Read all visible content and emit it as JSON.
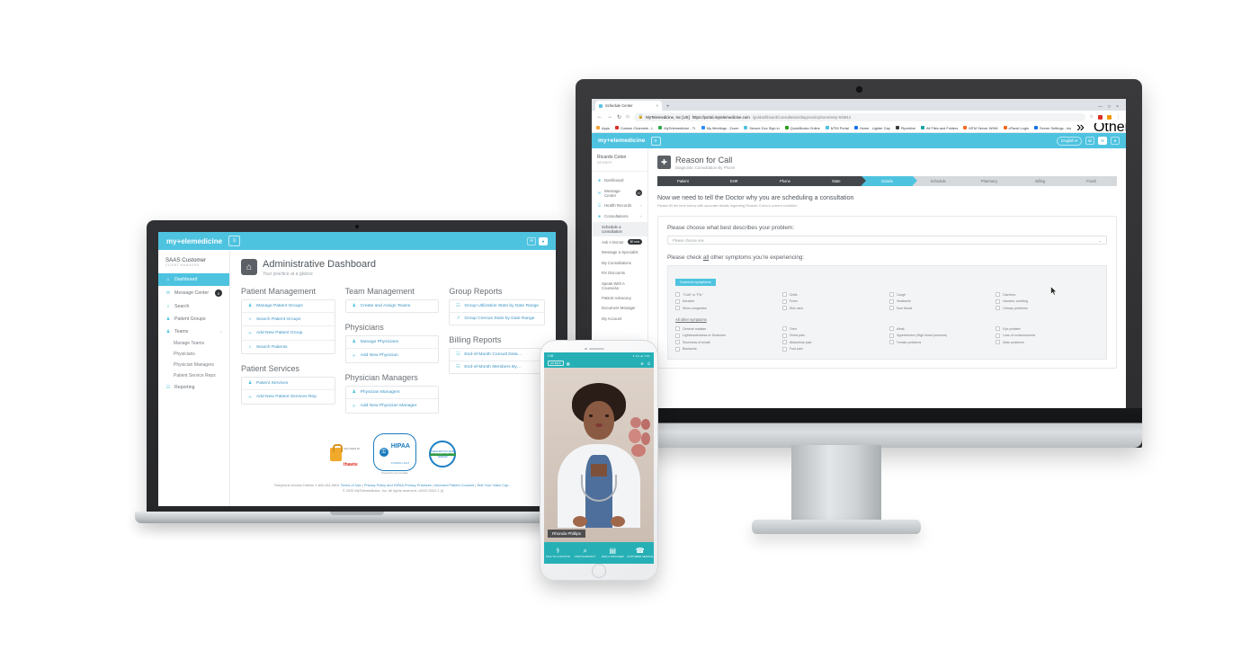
{
  "browser": {
    "tab_title": "Schedule Center",
    "tab_close": "×",
    "new_tab": "+",
    "secure_label": "MyTelemedicine, Inc [US]",
    "url_strong": "https://portal.mytelemedicine.com",
    "url_dim": "/go/dashboard/consultation/diagnostic/phone/step-5/8944",
    "bookmarks": [
      {
        "label": "Apps",
        "color": "#f2a43a"
      },
      {
        "label": "Custom Channels - L",
        "color": "#d93025"
      },
      {
        "label": "MyTelemedicine - Ti.",
        "color": "#34a853"
      },
      {
        "label": "My Meetings - Zoom",
        "color": "#2d8cff"
      },
      {
        "label": "Secure Doc Sign in",
        "color": "#4ec3e0"
      },
      {
        "label": "QuickBooks Online",
        "color": "#2ca01c"
      },
      {
        "label": "MTM Portal",
        "color": "#4ec3e0"
      },
      {
        "label": "Home - Lighter Cap",
        "color": "#1a73e8"
      },
      {
        "label": "Pipedrive",
        "color": "#3c3c3c"
      },
      {
        "label": "All Files and Folders",
        "color": "#1aa3a3"
      },
      {
        "label": "MTM Server WHM",
        "color": "#f26d21"
      },
      {
        "label": "cPanel Login",
        "color": "#f26d21"
      },
      {
        "label": "Server Settings - ins",
        "color": "#1a73e8"
      }
    ],
    "bookmarks_overflow": "»",
    "other_bookmarks": "Other bookmarks",
    "window_controls": [
      "—",
      "□",
      "×"
    ]
  },
  "desktop_app": {
    "logo": "my+elemedicine",
    "menu_icon": "≡",
    "language": "English ▾",
    "icon_cart": "⛁",
    "icon_mail": "✉",
    "icon_user": "●",
    "user": {
      "name": "Ricardo Colon",
      "role": "MEMBER"
    },
    "nav": [
      {
        "label": "Dashboard",
        "icon": "■",
        "state": "normal"
      },
      {
        "label": "Message Center",
        "icon": "✉",
        "state": "normal",
        "badge": "10"
      },
      {
        "label": "Health Records",
        "icon": "☰",
        "state": "normal",
        "chevron": "˅"
      },
      {
        "label": "Consultations",
        "icon": "■",
        "state": "normal",
        "chevron": "˅"
      },
      {
        "label": "Schedule a consultation",
        "sub": true,
        "state": "active"
      },
      {
        "label": "Ask A Doctor",
        "sub": true,
        "state": "normal",
        "tag": "$0 now"
      },
      {
        "label": "Message a Specialist",
        "sub": true,
        "state": "normal"
      },
      {
        "label": "My Consultations",
        "sub": true,
        "state": "normal"
      },
      {
        "label": "RX Discounts",
        "sub": true,
        "state": "normal"
      },
      {
        "label": "Speak With A Counselor",
        "sub": true,
        "state": "normal"
      },
      {
        "label": "Patient Advocacy",
        "sub": true,
        "state": "normal"
      },
      {
        "label": "Document Manager",
        "sub": true,
        "state": "normal"
      },
      {
        "label": "My Account",
        "sub": true,
        "state": "normal"
      }
    ],
    "page": {
      "icon": "✚",
      "title": "Reason for Call",
      "subtitle": "Diagnostic Consultation By Phone",
      "steps": [
        {
          "label": "Patient",
          "state": "done"
        },
        {
          "label": "EHR",
          "state": "done"
        },
        {
          "label": "Phone",
          "state": "done"
        },
        {
          "label": "State",
          "state": "done"
        },
        {
          "label": "Details",
          "state": "active"
        },
        {
          "label": "Schedule",
          "state": "upcoming"
        },
        {
          "label": "Pharmacy",
          "state": "upcoming"
        },
        {
          "label": "Billing",
          "state": "upcoming"
        },
        {
          "label": "Finish",
          "state": "upcoming"
        }
      ],
      "heading": "Now we need to tell the Doctor why you are scheduling a consultation",
      "subheading": "Please fill the form below with accurate details regarding Ricardo Colon's current condition",
      "problem_label": "Please choose what best describes your problem:",
      "problem_value": "Please choose one",
      "select_arrow": "⌄",
      "symptoms_label_pre": "Please check ",
      "symptoms_label_u": "all",
      "symptoms_label_post": " other symptoms you're experiencing:",
      "common_tag": "Common symptoms",
      "common_symptoms": [
        "\"Cold\" or \"Flu\"",
        "Chills",
        "Cough",
        "Diarrhea",
        "Earache",
        "Fever",
        "Headache",
        "Nausea, vomiting",
        "Sinus congestion",
        "Skin rash",
        "Sore throat",
        "Urinary problems"
      ],
      "all_other_label": "All other symptoms",
      "other_symptoms": [
        "General malaise",
        "Tired",
        "Weak",
        "Eye problem",
        "Lightheadedness or Dizziness",
        "Chest pain",
        "Hypertension (High blood pressure)",
        "Loss of consciousness",
        "Shortness of breath",
        "Abdominal pain",
        "Female problems",
        "Male problems",
        "Backache",
        "Foot pain",
        "",
        ""
      ]
    }
  },
  "laptop_app": {
    "logo": "my+elemedicine",
    "menu_icon": "≡",
    "icon_mail": "✉",
    "icon_user": "●",
    "user": {
      "name": "SAAS Customer",
      "role": "CLIENT MANAGER"
    },
    "nav": [
      {
        "label": "Dashboard",
        "icon": "⌂",
        "state": "active"
      },
      {
        "label": "Message Center",
        "icon": "✉",
        "state": "normal",
        "badge": "0"
      },
      {
        "label": "Search",
        "icon": "⌕",
        "state": "normal"
      },
      {
        "label": "Patient Groups",
        "icon": "♟",
        "state": "normal"
      },
      {
        "label": "Teams",
        "icon": "♟",
        "state": "normal",
        "chevron": "˅"
      },
      {
        "label": "Manage Teams",
        "sub": true
      },
      {
        "label": "Physicians",
        "sub": true
      },
      {
        "label": "Physician Managers",
        "sub": true
      },
      {
        "label": "Patient Service Reps",
        "sub": true
      },
      {
        "label": "Reporting",
        "icon": "☷",
        "state": "normal"
      }
    ],
    "page": {
      "icon": "⌂",
      "title": "Administrative Dashboard",
      "subtitle": "Your practice at a glance"
    },
    "sections": [
      {
        "heading": "Patient Management",
        "links": [
          {
            "label": "Manage Patient Groups",
            "icon": "♟"
          },
          {
            "label": "Search Patient Groups",
            "icon": "⌕"
          },
          {
            "label": "Add New Patient Group",
            "icon": "＋"
          },
          {
            "label": "Search Patients",
            "icon": "⌕"
          }
        ]
      },
      {
        "heading": "Team Management",
        "links": [
          {
            "label": "Create and Assign Teams",
            "icon": "♟"
          }
        ]
      },
      {
        "heading": "Group Reports",
        "links": [
          {
            "label": "Group Utilization Stats by Date Range",
            "icon": "☷"
          },
          {
            "label": "Group Census Stats by Date Range",
            "icon": "↗"
          }
        ]
      },
      {
        "heading": "Physicians",
        "links": [
          {
            "label": "Manage Physicians",
            "icon": "♟"
          },
          {
            "label": "Add New Physician",
            "icon": "＋"
          }
        ]
      },
      {
        "heading": "Billing Reports",
        "links": [
          {
            "label": "End-of-Month Consult Deta…",
            "icon": "☷"
          },
          {
            "label": "End-of-Month Members By…",
            "icon": "☷"
          }
        ]
      },
      {
        "heading": "Patient Services",
        "links": [
          {
            "label": "Patient Services",
            "icon": "♟"
          },
          {
            "label": "Add New Patient Services Rep",
            "icon": "＋"
          }
        ]
      },
      {
        "heading": "Physician Managers",
        "links": [
          {
            "label": "Physician Managers",
            "icon": "♟"
          },
          {
            "label": "Add New Physician Manager",
            "icon": "＋"
          }
        ]
      }
    ],
    "badges": {
      "norton_small": "SECURED BY",
      "norton_brand": "thawte",
      "hipaa_icon": "⚿",
      "hipaa_title": "HIPAA",
      "hipaa_sub": "COMPLIANT",
      "hipaa_powered": "Powered by Accountable",
      "seal_top": "PRESCRIPTION SAFE",
      "seal_mid": "MYTELEMEDICINE.COM",
      "seal_bottom": "VERIFIED"
    },
    "footer": {
      "line1_a": "Telephone Access Hotline 1-800-611-5601 ",
      "link_terms": "Terms of Use",
      "sep1": " | ",
      "link_privacy": "Privacy Policy and HIPAA Privacy Practices",
      "sep2": " | ",
      "link_consent": "Informed Patient Consent",
      "sep3": " | ",
      "link_video": "Test Your Video Cap…",
      "line2": "© 2020 MyTelemedicine, Inc. All rights reserved. v2020.0322.1 (i)"
    }
  },
  "phone_app": {
    "status_time": "1:08",
    "status_right": "▾ 4G ▰ 73%",
    "back_label": "GO BACK",
    "grid_icon": "▦",
    "settings_icon": "⚙",
    "power_icon": "⏻",
    "caller_name": "Rhonda Phillips",
    "nav": [
      {
        "label": "TALK TO A\nDOCTOR",
        "icon": "⚕"
      },
      {
        "label": "FIND\nPHARMACY",
        "icon": "⌕"
      },
      {
        "label": "FIND A\nPROVIDER",
        "icon": "▤"
      },
      {
        "label": "CUSTOMER\nSERVICE",
        "icon": "☎"
      }
    ]
  },
  "colors": {
    "brand": "#4ec3e0",
    "phone_brand": "#26b0b6",
    "link": "#3c93c4",
    "dark_step": "#44484c"
  }
}
